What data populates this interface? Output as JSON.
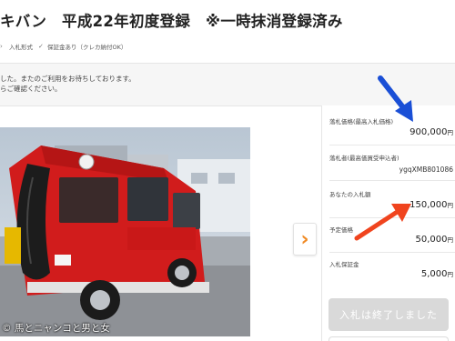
{
  "header": {
    "title": "キバン　平成22年初度登録　※一時抹消登録済み"
  },
  "meta": {
    "auction_type": "入札形式",
    "deposit": "保証金あり（クレカ納付OK）"
  },
  "notice": {
    "line1": "した。またのご利用をお待ちしております。",
    "line2": "らご確認ください。"
  },
  "photo": {
    "credit": "© 馬とニャンコと男と女"
  },
  "bid_panel": {
    "winning_price_label": "落札価格(最高入札価格)",
    "winning_price_value": "900,000",
    "winning_price_unit": "円",
    "winner_label": "落札者(最高価買受申込者)",
    "winner_id": "ygqXMB801086",
    "your_bid_label": "あなたの入札額",
    "your_bid_value": "150,000",
    "your_bid_unit": "円",
    "reserve_label": "予定価格",
    "reserve_value": "50,000",
    "reserve_unit": "円",
    "deposit_label": "入札保証金",
    "deposit_value": "5,000",
    "deposit_unit": "円",
    "end_button": "入札は終了しました"
  },
  "colors": {
    "accent_orange": "#f08a24",
    "annotation_blue": "#1a4fd6",
    "annotation_red": "#f0441e",
    "disabled_button": "#d9d9d9"
  }
}
